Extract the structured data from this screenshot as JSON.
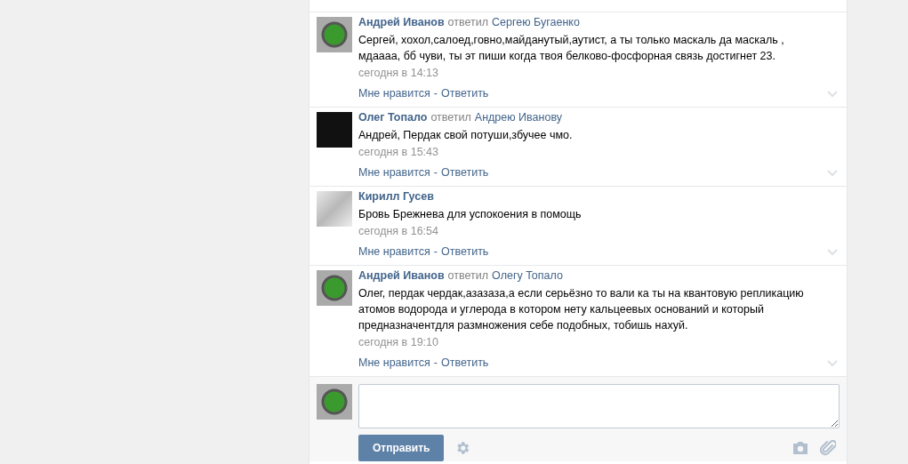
{
  "comments": [
    {
      "author": "Андрей Иванов",
      "avatar": {
        "kind": "creeper"
      },
      "verb": "ответил",
      "reply_to": "Сергею Бугаенко",
      "text": "Сергей, хохол,салоед,говно,майданутый,аутист, а ты только маскаль да маскаль , мдаааа, бб чуви, ты эт пиши когда твоя белково-фосфорная связь достигнет 23.",
      "time": "сегодня в 14:13",
      "like": "Мне нравится",
      "separator": "-",
      "reply": "Ответить"
    },
    {
      "author": "Олег Топало",
      "avatar": {
        "kind": "dark"
      },
      "verb": "ответил",
      "reply_to": "Андрею Иванову",
      "text": "Андрей, Пердак свой потуши,збучее чмо.",
      "time": "сегодня в 15:43",
      "like": "Мне нравится",
      "separator": "-",
      "reply": "Ответить"
    },
    {
      "author": "Кирилл Гусев",
      "avatar": {
        "kind": "sketch"
      },
      "text": "Бровь Брежнева для успокоения в помощь",
      "time": "сегодня в 16:54",
      "like": "Мне нравится",
      "separator": "-",
      "reply": "Ответить"
    },
    {
      "author": "Андрей Иванов",
      "avatar": {
        "kind": "creeper"
      },
      "verb": "ответил",
      "reply_to": "Олегу Топало",
      "text": "Олег, пердак чердак,азазаза,а если серьёзно то вали ка ты на квантовую репликацию атомов водорода и углерода в котором нету кальцеевых оснований и который предназначентдля размножения себе подобных, тобишь нахуй.",
      "time": "сегодня в 19:10",
      "like": "Мне нравится",
      "separator": "-",
      "reply": "Ответить"
    }
  ],
  "compose": {
    "avatar": {
      "kind": "creeper"
    },
    "send_button": "Отправить"
  }
}
